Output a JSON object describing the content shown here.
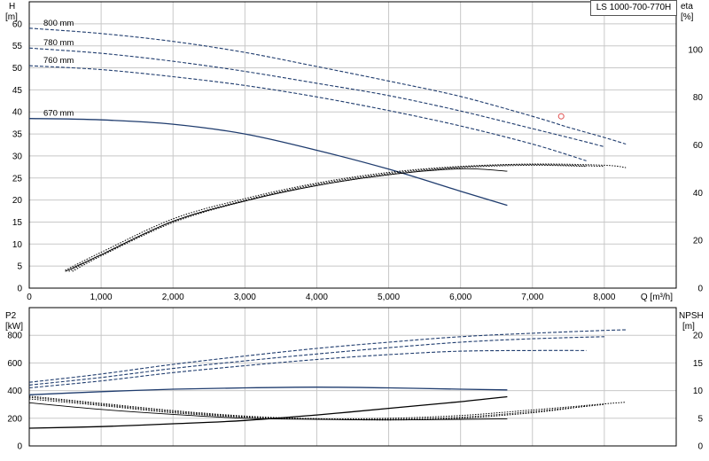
{
  "title": "LS 1000-700-770H",
  "colors": {
    "primary": "#1f3c6e",
    "dashed": "#1f3c6e",
    "eta": "#000000",
    "marker": "#e05050",
    "grid": "#c8c8c8"
  },
  "top_axes": {
    "y_left_label": [
      "H",
      "[m]"
    ],
    "y_right_label": [
      "eta",
      "[%]"
    ],
    "x_label": "Q [m³/h]",
    "y_left_ticks": [
      "0",
      "5",
      "10",
      "15",
      "20",
      "25",
      "30",
      "35",
      "40",
      "45",
      "50",
      "55",
      "60"
    ],
    "y_right_ticks": [
      "0",
      "20",
      "40",
      "60",
      "80",
      "100"
    ],
    "x_ticks": [
      "0",
      "1,000",
      "2,000",
      "3,000",
      "4,000",
      "5,000",
      "6,000",
      "7,000",
      "8,000"
    ]
  },
  "bottom_axes": {
    "y_left_label": [
      "P2",
      "[kW]"
    ],
    "y_right_label": [
      "NPSH",
      "[m]"
    ],
    "y_left_ticks": [
      "0",
      "200",
      "400",
      "600",
      "800"
    ],
    "y_right_ticks": [
      "0",
      "5",
      "10",
      "15",
      "20"
    ]
  },
  "curve_labels": [
    "800 mm",
    "780 mm",
    "760 mm",
    "670 mm"
  ],
  "chart_data": [
    {
      "type": "line",
      "panel": "head-efficiency",
      "xlabel": "Q [m³/h]",
      "ylabel": "H [m]",
      "y2label": "eta [%]",
      "xlim": [
        0,
        9000
      ],
      "ylim": [
        0,
        65
      ],
      "y2lim": [
        0,
        120
      ],
      "series": [
        {
          "name": "800 mm",
          "axis": "H",
          "style": "dashed",
          "x": [
            0,
            1000,
            2000,
            3000,
            4000,
            5000,
            6000,
            7000,
            7500,
            8000,
            8300
          ],
          "y": [
            59,
            57.8,
            56,
            53.5,
            50.3,
            47,
            43.5,
            39,
            36.5,
            34.2,
            32.7
          ]
        },
        {
          "name": "780 mm",
          "axis": "H",
          "style": "dashed",
          "x": [
            0,
            1000,
            2000,
            3000,
            4000,
            5000,
            6000,
            7000,
            7500,
            8000
          ],
          "y": [
            54.5,
            53.3,
            51.5,
            49.2,
            46.5,
            43.7,
            40.2,
            36.2,
            34.2,
            32.1
          ]
        },
        {
          "name": "760 mm",
          "axis": "H",
          "style": "dashed",
          "x": [
            0,
            1000,
            2000,
            3000,
            4000,
            5000,
            6000,
            7000,
            7750
          ],
          "y": [
            50.5,
            49.6,
            48,
            46,
            43.4,
            40.3,
            36.8,
            32.7,
            28.9
          ]
        },
        {
          "name": "670 mm",
          "axis": "H",
          "style": "solid",
          "x": [
            0,
            1000,
            2000,
            3000,
            4000,
            5000,
            6000,
            6650
          ],
          "y": [
            38.5,
            38.2,
            37.2,
            35,
            31.3,
            27,
            22,
            18.8
          ]
        },
        {
          "name": "eta 800 mm",
          "axis": "eta",
          "style": "dotted",
          "x": [
            500,
            1000,
            2000,
            3000,
            4000,
            5000,
            6000,
            7000,
            8000,
            8300
          ],
          "y": [
            7.5,
            15,
            29,
            37.5,
            44,
            48.5,
            51,
            52,
            51.5,
            50.5
          ]
        },
        {
          "name": "eta 780 mm",
          "axis": "eta",
          "style": "dotted",
          "x": [
            550,
            1000,
            2000,
            3000,
            4000,
            5000,
            6000,
            7000,
            8000
          ],
          "y": [
            7,
            14,
            28,
            36.8,
            43.5,
            48,
            50.8,
            51.8,
            51
          ]
        },
        {
          "name": "eta 760 mm",
          "axis": "eta",
          "style": "dotted",
          "x": [
            600,
            1000,
            2000,
            3000,
            4000,
            5000,
            6000,
            7000,
            7750
          ],
          "y": [
            7,
            13.5,
            27.5,
            36.5,
            43,
            47.5,
            50.5,
            51.5,
            51
          ]
        },
        {
          "name": "eta 670 mm",
          "axis": "eta",
          "style": "solid-thin",
          "x": [
            500,
            1000,
            2000,
            3000,
            4000,
            5000,
            6000,
            6650
          ],
          "y": [
            7,
            14,
            28,
            36.5,
            43,
            47.5,
            50,
            49
          ]
        }
      ],
      "markers": [
        {
          "x": 7400,
          "y": 39.0,
          "shape": "circle"
        }
      ]
    },
    {
      "type": "line",
      "panel": "power-npsh",
      "xlabel": "Q [m³/h]",
      "ylabel": "P2 [kW]",
      "y2label": "NPSH [m]",
      "xlim": [
        0,
        9000
      ],
      "ylim": [
        0,
        1000
      ],
      "y2lim": [
        0,
        25
      ],
      "series": [
        {
          "name": "P2 800 mm",
          "axis": "P2",
          "style": "dashed",
          "x": [
            0,
            1000,
            2000,
            3000,
            4000,
            5000,
            6000,
            7000,
            8000,
            8300
          ],
          "y": [
            460,
            520,
            590,
            650,
            705,
            750,
            790,
            815,
            835,
            840
          ]
        },
        {
          "name": "P2 780 mm",
          "axis": "P2",
          "style": "dashed",
          "x": [
            0,
            1000,
            2000,
            3000,
            4000,
            5000,
            6000,
            7000,
            8000
          ],
          "y": [
            440,
            495,
            560,
            615,
            665,
            710,
            750,
            775,
            790
          ]
        },
        {
          "name": "P2 760 mm",
          "axis": "P2",
          "style": "dashed",
          "x": [
            0,
            1000,
            2000,
            3000,
            4000,
            5000,
            6000,
            7000,
            7750
          ],
          "y": [
            420,
            470,
            530,
            580,
            625,
            660,
            685,
            690,
            690
          ]
        },
        {
          "name": "P2 670 mm",
          "axis": "P2",
          "style": "solid",
          "x": [
            0,
            1000,
            2000,
            3000,
            4000,
            5000,
            6000,
            6650
          ],
          "y": [
            370,
            392,
            410,
            420,
            425,
            420,
            410,
            405
          ]
        },
        {
          "name": "NPSH 800 mm",
          "axis": "NPSH",
          "style": "dotted",
          "x": [
            0,
            1000,
            2000,
            3000,
            4000,
            5000,
            6000,
            7000,
            8000,
            8300
          ],
          "y": [
            8.5,
            7.3,
            6.0,
            5.2,
            4.9,
            5.0,
            5.5,
            6.5,
            7.6,
            7.9
          ]
        },
        {
          "name": "NPSH 780 mm",
          "axis": "NPSH",
          "style": "dotted",
          "x": [
            0,
            1000,
            2000,
            3000,
            4000,
            5000,
            6000,
            7000,
            8000
          ],
          "y": [
            8.8,
            7.5,
            6.2,
            5.3,
            4.9,
            4.8,
            5.2,
            6.2,
            7.5
          ]
        },
        {
          "name": "NPSH 760 mm",
          "axis": "NPSH",
          "style": "dotted",
          "x": [
            0,
            1000,
            2000,
            3000,
            4000,
            5000,
            6000,
            7000,
            7750
          ],
          "y": [
            9.0,
            7.7,
            6.4,
            5.4,
            4.9,
            4.7,
            5.0,
            6.0,
            7.2
          ]
        },
        {
          "name": "NPSH 670 mm",
          "axis": "NPSH",
          "style": "solid-thin",
          "x": [
            0,
            1000,
            2000,
            3000,
            4000,
            5000,
            6000,
            6650
          ],
          "y": [
            7.8,
            6.6,
            5.7,
            5.0,
            4.8,
            4.7,
            4.8,
            4.9
          ]
        },
        {
          "name": "NPSH rising",
          "axis": "NPSH",
          "style": "solid",
          "x": [
            0,
            1000,
            2000,
            3000,
            4000,
            5000,
            6000,
            6650
          ],
          "y": [
            3.2,
            3.5,
            4.0,
            4.6,
            5.6,
            6.8,
            8.0,
            8.9
          ]
        }
      ]
    }
  ]
}
